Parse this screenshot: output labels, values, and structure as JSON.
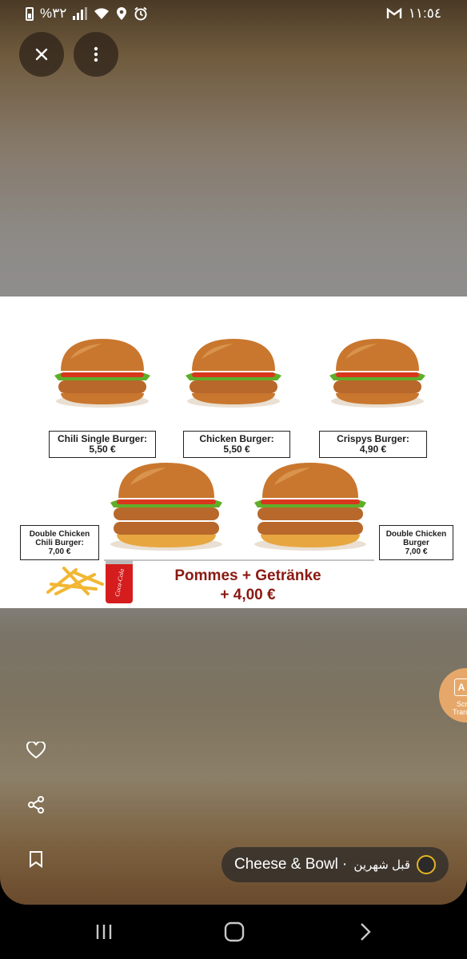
{
  "status_bar": {
    "battery": "%٣٢",
    "time": "١١:٥٤",
    "icons": [
      "battery-icon",
      "signal-icon",
      "wifi-icon",
      "location-icon",
      "alarm-icon",
      "gmail-icon"
    ]
  },
  "top_actions": {
    "close_icon": "close-icon",
    "more_icon": "more-vertical-icon"
  },
  "menu_image": {
    "items": [
      {
        "name": "Chili Single Burger:",
        "price": "5,50 €"
      },
      {
        "name": "Chicken Burger:",
        "price": "5,50 €"
      },
      {
        "name": "Crispys Burger:",
        "price": "4,90 €"
      },
      {
        "name1": "Double Chicken",
        "name2": "Chili Burger:",
        "price": "7,00 €"
      },
      {
        "name1": "Double Chicken",
        "name2": "Burger",
        "price": "7,00 €"
      }
    ],
    "promo_line1": "Pommes + Getränke",
    "promo_line2": "+ 4,00 €",
    "can_label": "Coca-Cola",
    "colors": {
      "promo": "#8a1a12",
      "bun": "#c9772e",
      "lettuce": "#5fae2a",
      "tomato": "#d8371e",
      "chicken": "#b8682b"
    }
  },
  "side_actions": [
    "heart-icon",
    "share-icon",
    "bookmark-icon"
  ],
  "author": {
    "name": "Cheese & Bowl",
    "separator": "·",
    "time_ago": "قبل شهرين"
  },
  "translate_button": {
    "line1": "Scre",
    "line2": "Trans"
  },
  "nav_bar": [
    "recents-icon",
    "home-icon",
    "back-icon"
  ]
}
